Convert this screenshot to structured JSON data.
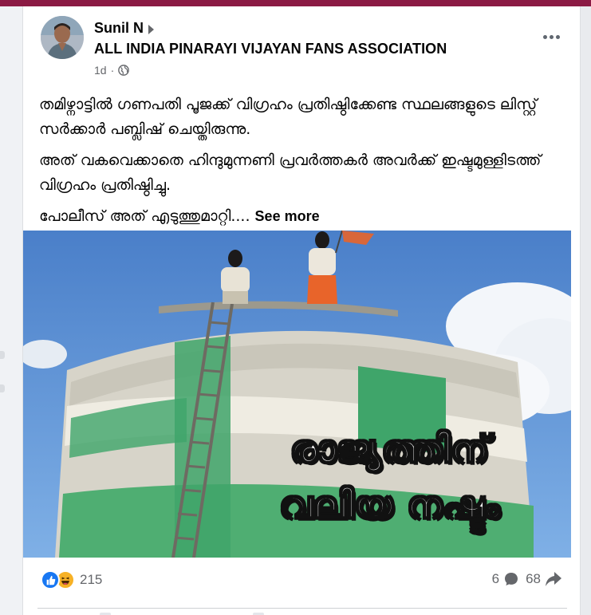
{
  "post": {
    "author": "Sunil N",
    "group": "ALL INDIA PINARAYI VIJAYAN FANS ASSOCIATION",
    "time": "1d",
    "privacy_icon": "globe-icon",
    "more_icon": "more-options-icon",
    "paragraphs": [
      "തമിഴ്നാട്ടിൽ ഗണപതി പൂജക്ക് വിഗ്രഹം പ്രതിഷ്ഠിക്കേണ്ട സ്ഥലങ്ങളുടെ ലിസ്റ്റ്  സർക്കാർ പബ്ലിഷ് ചെയ്തിരുന്നു.",
      "അത് വകവെക്കാതെ ഹിന്ദുമുന്നണി പ്രവർത്തകർ അവർക്ക് ഇഷ്ടമുള്ളിടത്ത് വിഗ്രഹം പ്രതിഷ്ഠിച്ചു."
    ],
    "truncated_line": "പോലീസ് അത് എടുത്തുമാറ്റി....",
    "see_more": "See more",
    "image_caption": [
      "രാജ്യത്തിന്",
      "വലിയ നഷ്ടം"
    ]
  },
  "footer": {
    "reaction_icons": [
      "like-icon",
      "haha-icon"
    ],
    "reaction_count": "215",
    "comment_count": "6",
    "share_count": "68"
  },
  "colors": {
    "top_strip": "#8b1a44",
    "sky": "#5a8fd4",
    "tank_green": "#3aa36b",
    "saffron": "#e8642a"
  }
}
